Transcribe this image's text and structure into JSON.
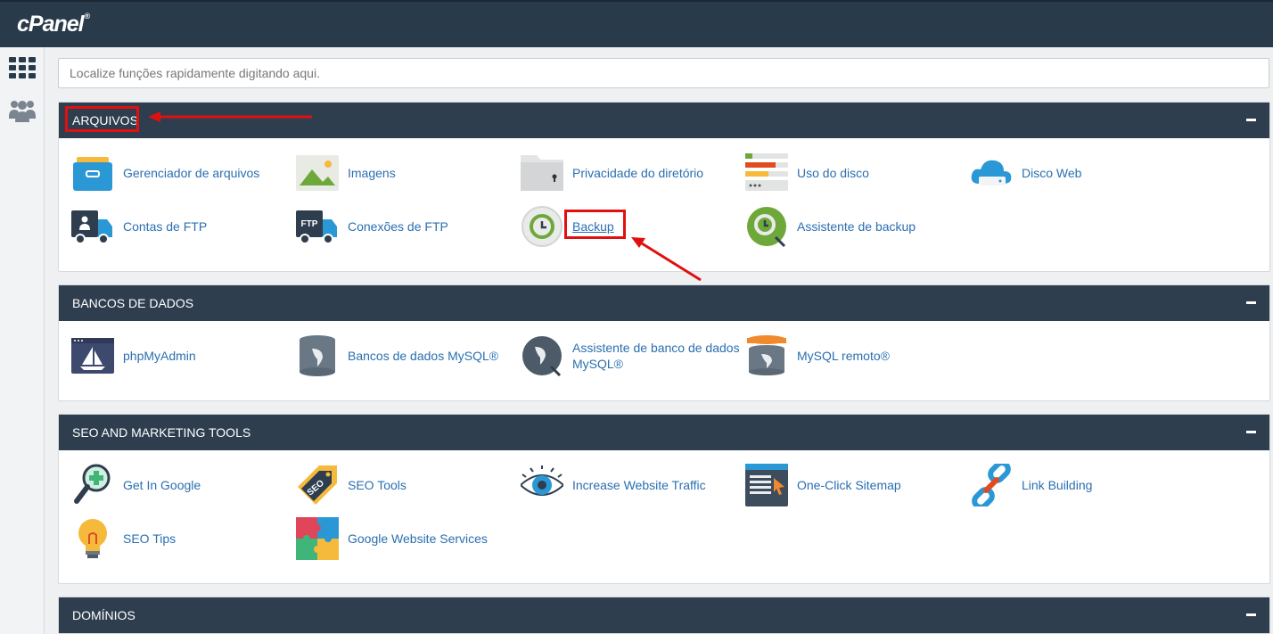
{
  "app": {
    "logo": "cPanel",
    "logo_mark": "®"
  },
  "search": {
    "placeholder": "Localize funções rapidamente digitando aqui."
  },
  "sections": [
    {
      "title": "ARQUIVOS",
      "items": [
        {
          "label": "Gerenciador de arquivos",
          "icon": "file-manager-icon"
        },
        {
          "label": "Imagens",
          "icon": "images-icon"
        },
        {
          "label": "Privacidade do diretório",
          "icon": "directory-privacy-icon"
        },
        {
          "label": "Uso do disco",
          "icon": "disk-usage-icon"
        },
        {
          "label": "Disco Web",
          "icon": "web-disk-icon"
        },
        {
          "label": "Contas de FTP",
          "icon": "ftp-accounts-icon"
        },
        {
          "label": "Conexões de FTP",
          "icon": "ftp-connections-icon",
          "icon_text": "FTP"
        },
        {
          "label": "Backup",
          "icon": "backup-icon"
        },
        {
          "label": "Assistente de backup",
          "icon": "backup-wizard-icon"
        }
      ]
    },
    {
      "title": "BANCOS DE DADOS",
      "items": [
        {
          "label": "phpMyAdmin",
          "icon": "phpmyadmin-icon"
        },
        {
          "label": "Bancos de dados MySQL®",
          "icon": "mysql-databases-icon"
        },
        {
          "label": "Assistente de banco de dados MySQL®",
          "icon": "mysql-wizard-icon"
        },
        {
          "label": "MySQL remoto®",
          "icon": "remote-mysql-icon"
        }
      ]
    },
    {
      "title": "SEO AND MARKETING TOOLS",
      "items": [
        {
          "label": "Get In Google",
          "icon": "magnifier-plus-icon"
        },
        {
          "label": "SEO Tools",
          "icon": "seo-tag-icon",
          "icon_text": "SEO"
        },
        {
          "label": "Increase Website Traffic",
          "icon": "eye-icon"
        },
        {
          "label": "One-Click Sitemap",
          "icon": "sitemap-icon"
        },
        {
          "label": "Link Building",
          "icon": "chain-link-icon"
        },
        {
          "label": "SEO Tips",
          "icon": "lightbulb-icon"
        },
        {
          "label": "Google Website Services",
          "icon": "puzzle-icon"
        }
      ]
    },
    {
      "title": "DOMÍNIOS",
      "items": []
    }
  ],
  "colors": {
    "header": "#2e3e4f",
    "topbar": "#293a4a",
    "link": "#2a6fb0",
    "highlight": "#e01010"
  }
}
